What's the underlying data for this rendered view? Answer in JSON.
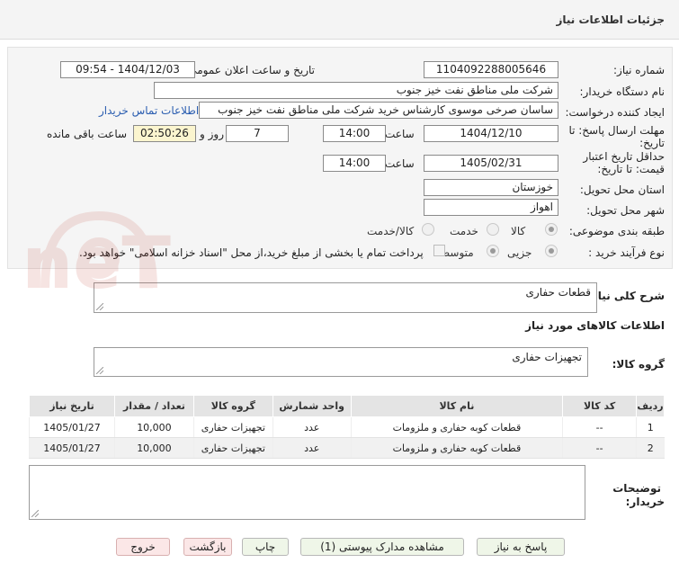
{
  "header": {
    "title": "جزئیات اطلاعات نیاز"
  },
  "form": {
    "need_number_label": "شماره نیاز:",
    "need_number": "1104092288005646",
    "announce_label": "تاریخ و ساعت اعلان عمومی:",
    "announce_value": "1404/12/03 - 09:54",
    "buyer_org_label": "نام دستگاه خریدار:",
    "buyer_org": "شرکت ملی مناطق نفت خیز جنوب",
    "creator_label": "ایجاد کننده درخواست:",
    "creator": "ساسان صرخی موسوی کارشناس خرید  شرکت ملی مناطق نفت خیز جنوب",
    "contact_link": "اطلاعات تماس خریدار",
    "deadline_label_1": "مهلت ارسال پاسخ: تا",
    "deadline_label_2": "تاریخ:",
    "deadline_date": "1404/12/10",
    "time_word": "ساعت",
    "deadline_time": "14:00",
    "days_value": "7",
    "days_word": "روز و",
    "remaining_time": "02:50:26",
    "remaining_word": "ساعت باقی مانده",
    "validity_label_1": "حداقل تاریخ اعتبار",
    "validity_label_2": "قیمت: تا تاریخ:",
    "validity_date": "1405/02/31",
    "validity_time": "14:00",
    "province_label": "استان محل تحویل:",
    "province": "خوزستان",
    "city_label": "شهر محل تحویل:",
    "city": "اهواز",
    "category_label": "طبقه بندی موضوعی:",
    "category_options": [
      "کالا",
      "خدمت",
      "کالا/خدمت"
    ],
    "category_selected": "کالا",
    "process_label": "نوع فرآیند خرید :",
    "process_options": [
      "جزیی",
      "متوسط"
    ],
    "process_selected": "جزیی",
    "payment_note": "پرداخت تمام یا بخشی از مبلغ خرید،از محل \"اسناد خزانه اسلامی\" خواهد بود."
  },
  "summary": {
    "label": "شرح کلی نیاز:",
    "value": "قطعات حفاری"
  },
  "goods_info_title": "اطلاعات کالاهای مورد نیاز",
  "goods_group": {
    "label": "گروه کالا:",
    "value": "تجهیزات حفاری"
  },
  "table": {
    "headers": [
      "ردیف",
      "کد کالا",
      "نام کالا",
      "واحد شمارش",
      "گروه کالا",
      "تعداد / مقدار",
      "تاریخ نیاز"
    ],
    "rows": [
      [
        "1",
        "--",
        "قطعات کوبه حفاری و ملزومات",
        "عدد",
        "تجهیزات حفاری",
        "10,000",
        "1405/01/27"
      ],
      [
        "2",
        "--",
        "قطعات کوبه حفاری و ملزومات",
        "عدد",
        "تجهیزات حفاری",
        "10,000",
        "1405/01/27"
      ]
    ]
  },
  "buyer_notes": {
    "label_1": "توضیحات",
    "label_2": "خریدار:",
    "value": ""
  },
  "buttons": {
    "reply": "پاسخ به نیاز",
    "attachments": "مشاهده مدارک پیوستی (1)",
    "print": "چاپ",
    "back": "بازگشت",
    "exit": "خروج"
  },
  "watermark": "AriaTender.neT",
  "colors": {
    "link": "#2a5db0",
    "highlight": "#fbf5cf",
    "button_green": "#eff6e8",
    "button_red": "#fbe7e7"
  }
}
